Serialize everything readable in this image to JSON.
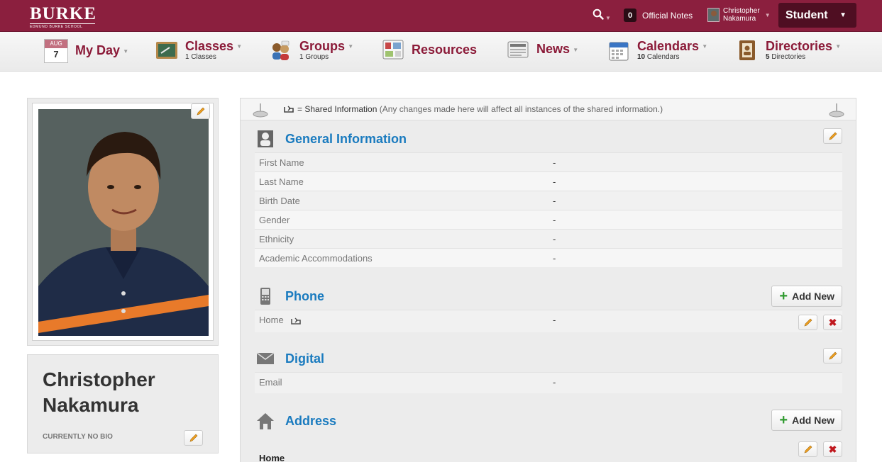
{
  "header": {
    "logo_main": "BURKE",
    "logo_sub": "EDMUND BURKE SCHOOL",
    "search_icon": "search-icon",
    "notes_count": "0",
    "notes_label": "Official Notes",
    "user_first": "Christopher",
    "user_last": "Nakamura",
    "role": "Student"
  },
  "nav": {
    "myday": {
      "month": "AUG",
      "day": "7",
      "label": "My Day"
    },
    "classes": {
      "label": "Classes",
      "sub": "1 Classes"
    },
    "groups": {
      "label": "Groups",
      "sub": "1 Groups"
    },
    "resources": {
      "label": "Resources"
    },
    "news": {
      "label": "News"
    },
    "calendars": {
      "label": "Calendars",
      "sub_count": "10",
      "sub_text": "Calendars"
    },
    "directories": {
      "label": "Directories",
      "sub_count": "5",
      "sub_text": "Directories"
    }
  },
  "profile": {
    "first": "Christopher",
    "last": "Nakamura",
    "bio": "CURRENTLY NO BIO"
  },
  "shared": {
    "label": "= Shared Information",
    "note": "(Any changes made here will affect all instances of the shared information.)"
  },
  "general": {
    "title": "General Information",
    "rows": [
      {
        "label": "First Name",
        "value": "-"
      },
      {
        "label": "Last Name",
        "value": "-"
      },
      {
        "label": "Birth Date",
        "value": "-"
      },
      {
        "label": "Gender",
        "value": "-"
      },
      {
        "label": "Ethnicity",
        "value": "-"
      },
      {
        "label": "Academic Accommodations",
        "value": "-"
      }
    ]
  },
  "phone": {
    "title": "Phone",
    "add_label": "Add New",
    "rows": [
      {
        "label": "Home",
        "value": "-"
      }
    ]
  },
  "digital": {
    "title": "Digital",
    "rows": [
      {
        "label": "Email",
        "value": "-"
      }
    ]
  },
  "address": {
    "title": "Address",
    "add_label": "Add New",
    "first_label": "Home"
  },
  "colors": {
    "brand": "#8b1f3e",
    "link_blue": "#1a7bbf",
    "add_green": "#2f9a2f",
    "delete_red": "#c0191f"
  }
}
